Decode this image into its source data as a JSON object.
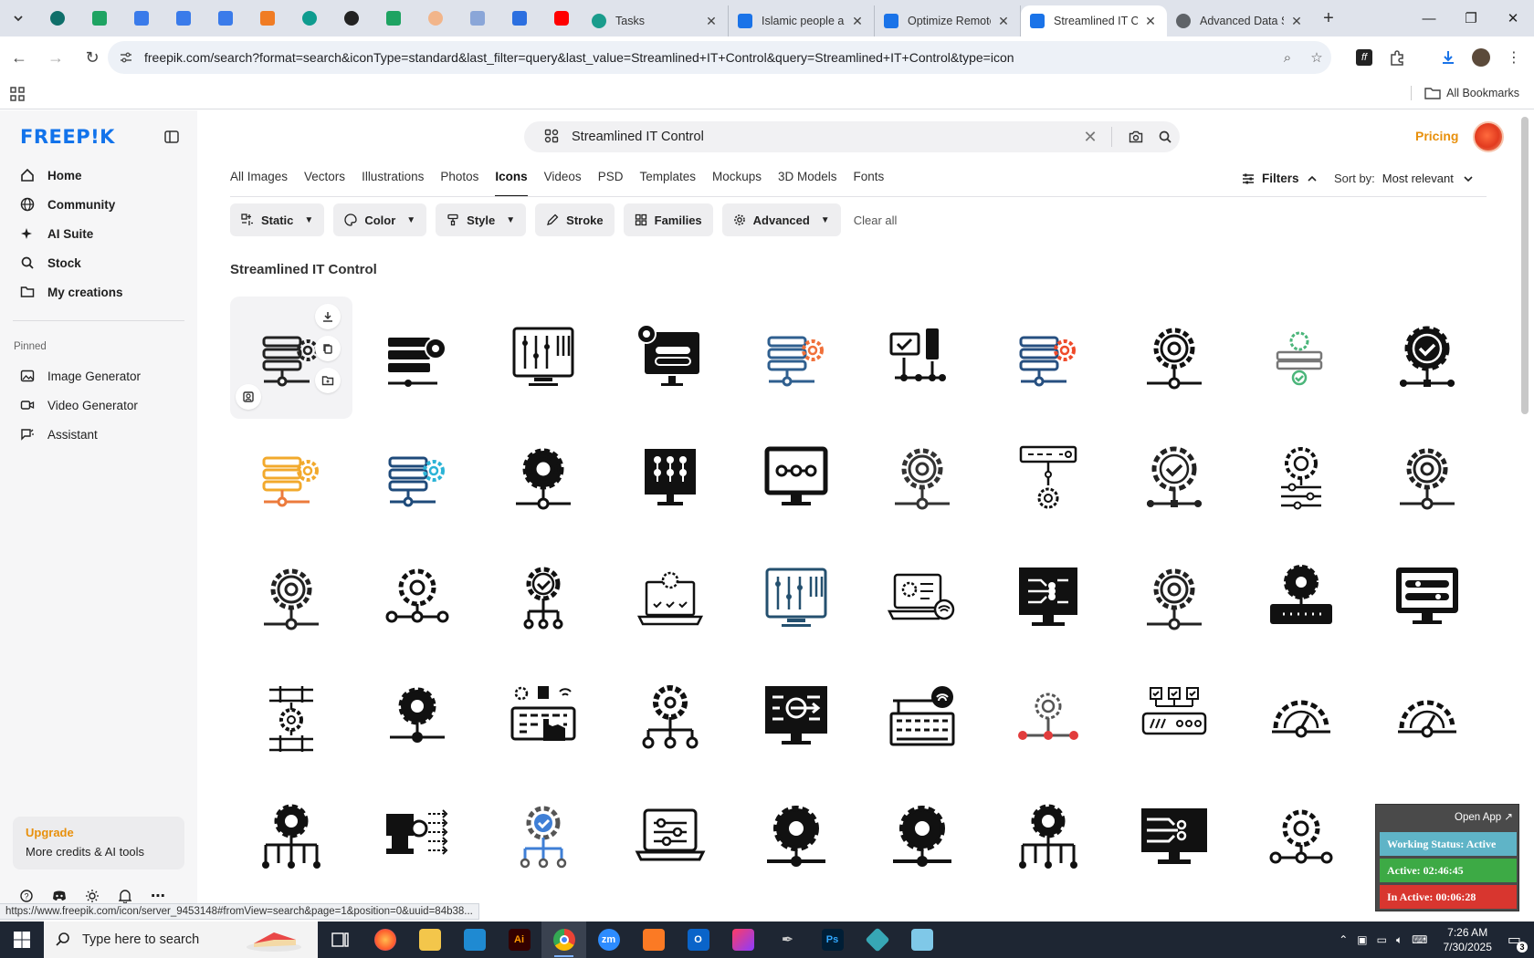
{
  "browser": {
    "tabs": [
      {
        "title": "Tasks",
        "color": "#1a9c8c"
      },
      {
        "title": "Islamic people an",
        "color": "#1a73e8"
      },
      {
        "title": "Optimize Remote",
        "color": "#1a73e8"
      },
      {
        "title": "Streamlined IT Co",
        "color": "#1a73e8"
      },
      {
        "title": "Advanced Data S",
        "color": "#5f6368"
      }
    ],
    "url": "freepik.com/search?format=search&iconType=standard&last_filter=query&last_value=Streamlined+IT+Control&query=Streamlined+IT+Control&type=icon",
    "all_bookmarks": "All Bookmarks",
    "status_url": "https://www.freepik.com/icon/server_9453148#fromView=search&page=1&position=0&uuid=84b38..."
  },
  "sidebar": {
    "logo": "FREEP!K",
    "nav": [
      {
        "label": "Home",
        "icon": "home-icon"
      },
      {
        "label": "Community",
        "icon": "globe-icon"
      },
      {
        "label": "AI Suite",
        "icon": "sparkle-icon"
      },
      {
        "label": "Stock",
        "icon": "search-icon"
      },
      {
        "label": "My creations",
        "icon": "folder-icon"
      }
    ],
    "pinned_label": "Pinned",
    "pinned": [
      {
        "label": "Image Generator",
        "icon": "image-icon"
      },
      {
        "label": "Video Generator",
        "icon": "video-icon"
      },
      {
        "label": "Assistant",
        "icon": "chat-icon"
      }
    ],
    "upgrade_title": "Upgrade",
    "upgrade_sub": "More credits & AI tools"
  },
  "header": {
    "search_query": "Streamlined IT Control",
    "pricing": "Pricing"
  },
  "categories": [
    "All Images",
    "Vectors",
    "Illustrations",
    "Photos",
    "Icons",
    "Videos",
    "PSD",
    "Templates",
    "Mockups",
    "3D Models",
    "Fonts"
  ],
  "active_category": "Icons",
  "filters_label": "Filters",
  "sort_label": "Sort by:",
  "sort_value": "Most relevant",
  "chips": [
    {
      "label": "Static",
      "dropdown": true,
      "icon": "sliders-icon"
    },
    {
      "label": "Color",
      "dropdown": true,
      "icon": "palette-icon"
    },
    {
      "label": "Style",
      "dropdown": true,
      "icon": "brush-icon"
    },
    {
      "label": "Stroke",
      "dropdown": false,
      "icon": "pen-icon"
    },
    {
      "label": "Families",
      "dropdown": false,
      "icon": "grid-icon"
    },
    {
      "label": "Advanced",
      "dropdown": true,
      "icon": "gear-icon"
    }
  ],
  "clear_all": "Clear all",
  "results_title": "Streamlined IT Control",
  "tracker": {
    "open_app": "Open App ↗",
    "working_status": "Working Status: Active",
    "active": "Active: 02:46:45",
    "inactive": "In Active: 00:06:28",
    "colors": {
      "working": "#5fb4c7",
      "active": "#3daa45",
      "inactive": "#d8362f"
    }
  },
  "taskbar": {
    "search_placeholder": "Type here to search",
    "time": "7:26 AM",
    "date": "7/30/2025",
    "notif_count": "3"
  }
}
